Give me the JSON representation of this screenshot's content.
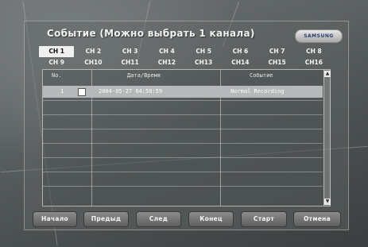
{
  "window": {
    "title": "Событие (Можно выбрать 1 канала)",
    "logo": "SAMSUNG"
  },
  "channels": [
    {
      "label": "CH 1",
      "selected": true
    },
    {
      "label": "CH 2",
      "selected": false
    },
    {
      "label": "CH 3",
      "selected": false
    },
    {
      "label": "CH 4",
      "selected": false
    },
    {
      "label": "CH 5",
      "selected": false
    },
    {
      "label": "CH 6",
      "selected": false
    },
    {
      "label": "CH 7",
      "selected": false
    },
    {
      "label": "CH 8",
      "selected": false
    },
    {
      "label": "CH 9",
      "selected": false
    },
    {
      "label": "CH10",
      "selected": false
    },
    {
      "label": "CH11",
      "selected": false
    },
    {
      "label": "CH12",
      "selected": false
    },
    {
      "label": "CH13",
      "selected": false
    },
    {
      "label": "CH14",
      "selected": false
    },
    {
      "label": "CH15",
      "selected": false
    },
    {
      "label": "CH16",
      "selected": false
    }
  ],
  "list": {
    "columns": {
      "no": "No.",
      "datetime": "Дата/Время",
      "event": "Событие"
    },
    "rows": [
      {
        "no": "1",
        "datetime": "2004-05-27  04:50:59",
        "event": "Normal Recording"
      }
    ]
  },
  "buttons": {
    "first": "Начало",
    "prev": "Предыд",
    "next": "След",
    "last": "Конец",
    "start": "Старт",
    "cancel": "Отмена"
  },
  "colors": {
    "selected_row": "#b5b9b9",
    "active_channel": "#f0f0f0"
  }
}
